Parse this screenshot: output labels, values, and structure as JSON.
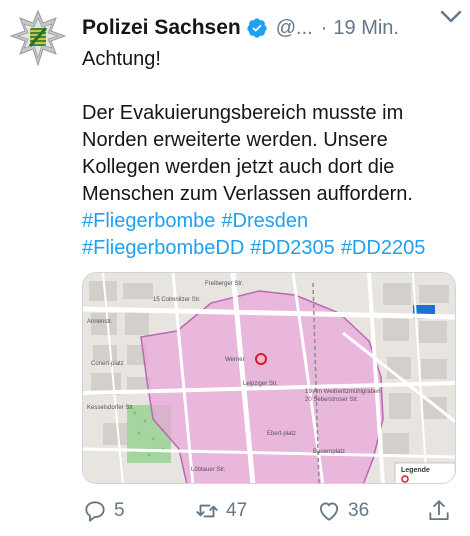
{
  "tweet": {
    "author_name": "Polizei Sachsen",
    "handle": "@...",
    "separator": "·",
    "time": "19 Min.",
    "lines": [
      "Achtung!",
      "Der Evakuierungsbereich musste im",
      "Norden erweiterte werden. Unsere",
      "Kollegen werden jetzt auch dort die",
      "Menschen zum Verlassen auffordern."
    ],
    "hashtags_line1": [
      "#Fliegerbombe",
      "#Dresden"
    ],
    "hashtags_line2": [
      "#FliegerbombeDD",
      "#DD2305",
      "#DD2205"
    ]
  },
  "map": {
    "labels": {
      "colmnitzer": "15 Colmnitzer Str.",
      "freiberger": "Freiberger Str.",
      "wernerstr": "Werner",
      "annenstr": "Annenstr.",
      "conert": "Conert-platz",
      "kesselsdorfer": "Kesselsdorfer Str.",
      "ebert": "Ebert-platz",
      "leipziger": "Leipziger Str.",
      "am_weisseritz": "19 Am Weißeritzmühlgraben",
      "saberstr": "20 Seberstroser Str.",
      "loebtauer": "Löbtauer Str.",
      "bauerplatz": "Bauernplatz",
      "legend": "Legende"
    },
    "colors": {
      "zone": "#e9a6d9",
      "zone_border": "#b86ab0",
      "roads": "#ffffff",
      "base": "#e8e5e1",
      "park": "#a6d6a0",
      "water": "#1f6fd6",
      "marker": "#d81b24"
    }
  },
  "actions": {
    "replies": "5",
    "retweets": "47",
    "likes": "36"
  },
  "icons": {
    "avatar": "police-star-badge-icon",
    "verified": "verified-badge-icon",
    "caret": "chevron-down-icon",
    "reply": "reply-icon",
    "retweet": "retweet-icon",
    "like": "heart-icon",
    "share": "share-icon"
  }
}
